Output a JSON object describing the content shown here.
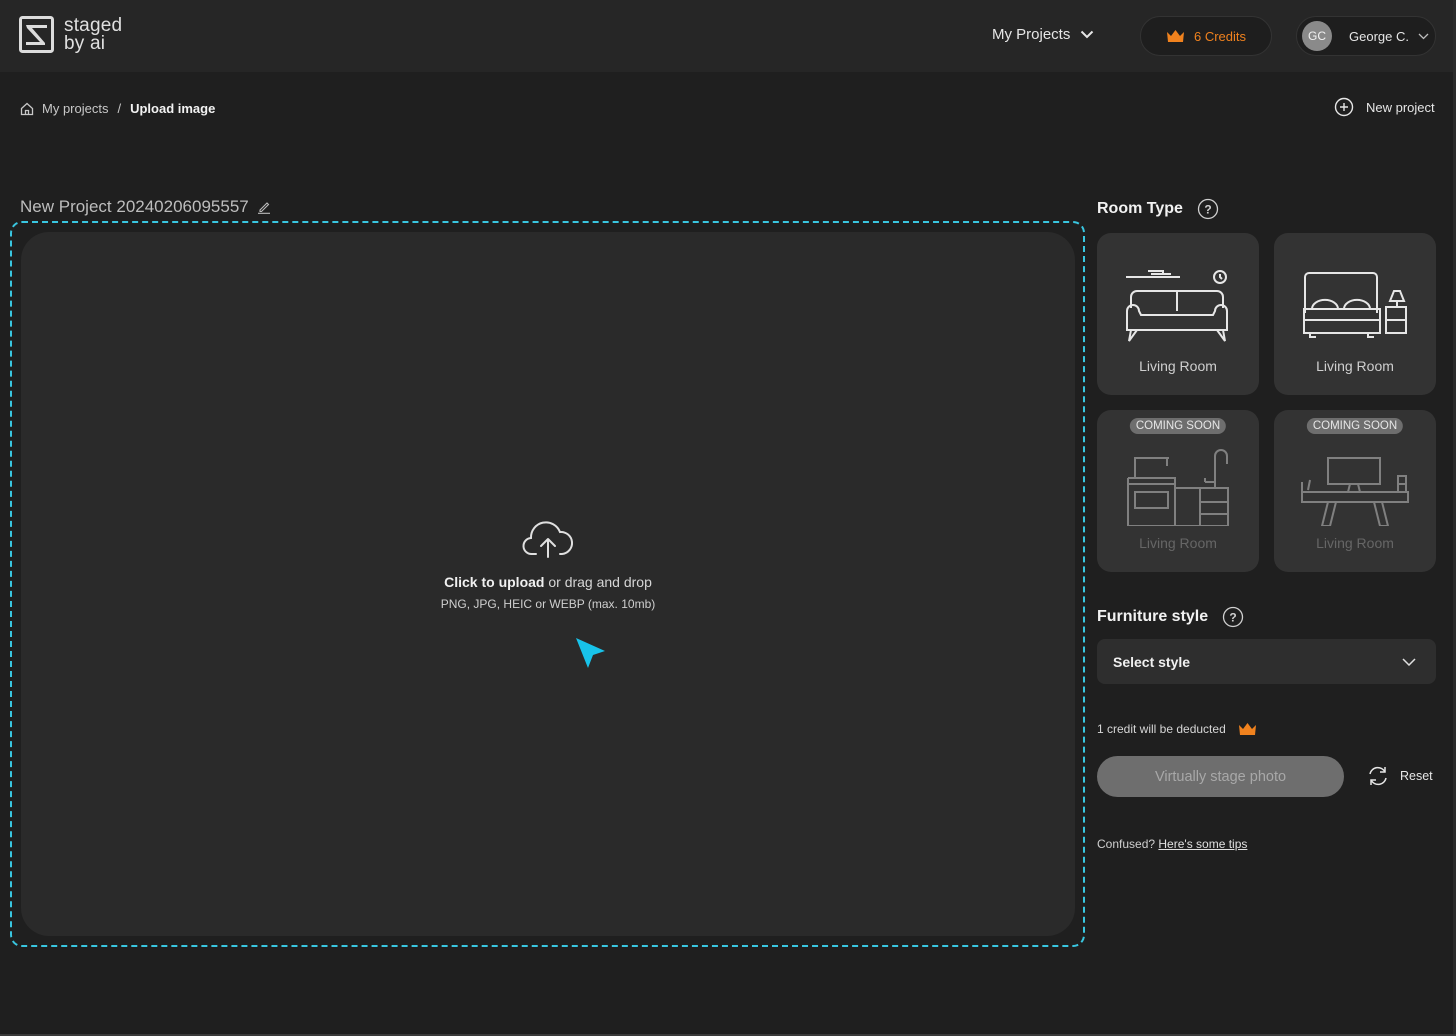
{
  "brand": {
    "line1": "staged",
    "line2": "by ai",
    "icon": "logo-mark-icon"
  },
  "nav": {
    "projects_label": "My Projects",
    "credits_label": "6 Credits",
    "credits_icon": "crown-icon",
    "user": {
      "initials": "GC",
      "name": "George C."
    }
  },
  "breadcrumb": {
    "home_icon": "home-icon",
    "items": [
      "My projects",
      "Upload image"
    ],
    "separator": "/"
  },
  "new_project_label": "New project",
  "project": {
    "title": "New Project 20240206095557",
    "edit_icon": "pencil-icon"
  },
  "upload": {
    "icon": "cloud-upload-icon",
    "main_bold": "Click to upload",
    "main_rest": " or drag and drop",
    "sub": "PNG, JPG, HEIC or WEBP (max. 10mb)",
    "accent_color": "#39c6e0"
  },
  "room_type": {
    "heading": "Room Type",
    "cards": [
      {
        "label": "Living Room",
        "icon": "sofa-icon",
        "badge": null,
        "enabled": true
      },
      {
        "label": "Living Room",
        "icon": "bed-icon",
        "badge": null,
        "enabled": true
      },
      {
        "label": "Living Room",
        "icon": "kitchen-icon",
        "badge": "COMING SOON",
        "enabled": false
      },
      {
        "label": "Living Room",
        "icon": "tv-stand-icon",
        "badge": "COMING SOON",
        "enabled": false
      }
    ]
  },
  "furniture_style": {
    "heading": "Furniture style",
    "select_value": "Select style"
  },
  "credit_note": "1 credit will be deducted",
  "stage_button": "Virtually stage photo",
  "reset_label": "Reset",
  "tips": {
    "prefix": "Confused? ",
    "link": "Here's some tips"
  },
  "colors": {
    "credit_orange": "#f0821e",
    "accent_cyan": "#39c6e0"
  }
}
